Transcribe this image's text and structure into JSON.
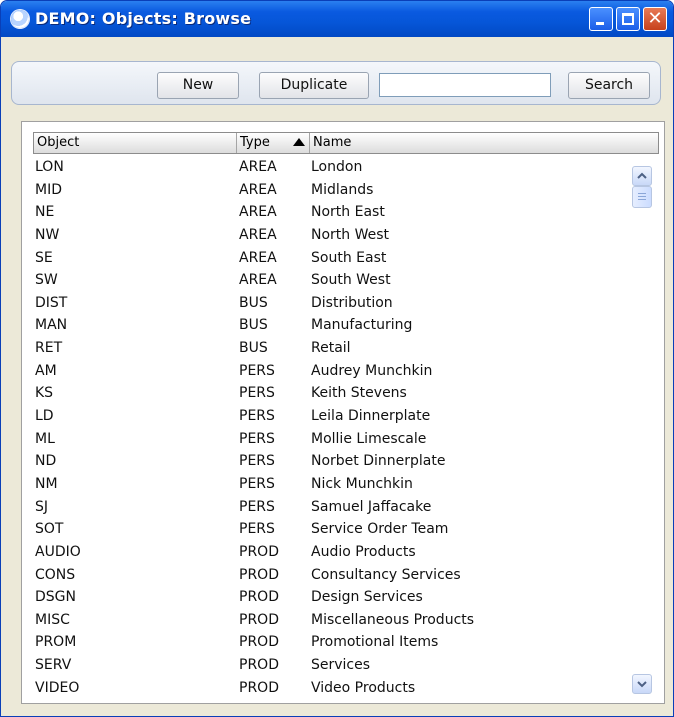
{
  "window": {
    "title": "DEMO: Objects: Browse"
  },
  "toolbar": {
    "new_label": "New",
    "duplicate_label": "Duplicate",
    "search_value": "",
    "search_label": "Search"
  },
  "table": {
    "columns": [
      "Object",
      "Type",
      "Name"
    ],
    "sort_column": "Type",
    "rows": [
      {
        "object": "LON",
        "type": "AREA",
        "name": "London"
      },
      {
        "object": "MID",
        "type": "AREA",
        "name": "Midlands"
      },
      {
        "object": "NE",
        "type": "AREA",
        "name": "North East"
      },
      {
        "object": "NW",
        "type": "AREA",
        "name": "North West"
      },
      {
        "object": "SE",
        "type": "AREA",
        "name": "South East"
      },
      {
        "object": "SW",
        "type": "AREA",
        "name": "South West"
      },
      {
        "object": "DIST",
        "type": "BUS",
        "name": "Distribution"
      },
      {
        "object": "MAN",
        "type": "BUS",
        "name": "Manufacturing"
      },
      {
        "object": "RET",
        "type": "BUS",
        "name": "Retail"
      },
      {
        "object": "AM",
        "type": "PERS",
        "name": "Audrey Munchkin"
      },
      {
        "object": "KS",
        "type": "PERS",
        "name": "Keith Stevens"
      },
      {
        "object": "LD",
        "type": "PERS",
        "name": "Leila Dinnerplate"
      },
      {
        "object": "ML",
        "type": "PERS",
        "name": "Mollie Limescale"
      },
      {
        "object": "ND",
        "type": "PERS",
        "name": "Norbet Dinnerplate"
      },
      {
        "object": "NM",
        "type": "PERS",
        "name": "Nick Munchkin"
      },
      {
        "object": "SJ",
        "type": "PERS",
        "name": "Samuel Jaffacake"
      },
      {
        "object": "SOT",
        "type": "PERS",
        "name": "Service Order Team"
      },
      {
        "object": "AUDIO",
        "type": "PROD",
        "name": "Audio Products"
      },
      {
        "object": "CONS",
        "type": "PROD",
        "name": "Consultancy Services"
      },
      {
        "object": "DSGN",
        "type": "PROD",
        "name": "Design Services"
      },
      {
        "object": "MISC",
        "type": "PROD",
        "name": "Miscellaneous Products"
      },
      {
        "object": "PROM",
        "type": "PROD",
        "name": "Promotional Items"
      },
      {
        "object": "SERV",
        "type": "PROD",
        "name": "Services"
      },
      {
        "object": "VIDEO",
        "type": "PROD",
        "name": "Video Products"
      }
    ]
  },
  "colors": {
    "titlebar": "#0656d8",
    "close_button": "#c7411c",
    "panel": "#ece9d8"
  }
}
